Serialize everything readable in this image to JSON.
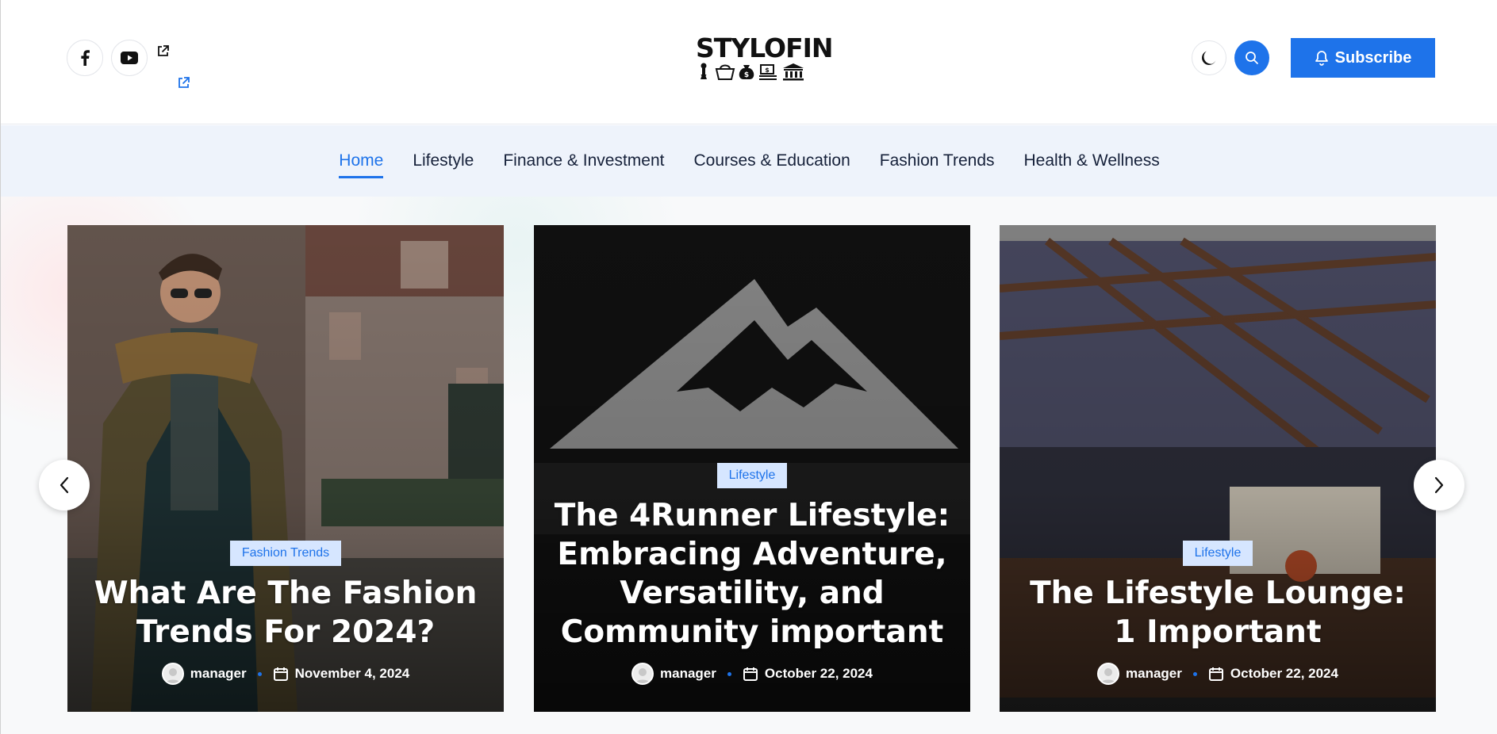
{
  "header": {
    "social": [
      {
        "icon": "facebook-icon",
        "label": "f"
      },
      {
        "icon": "youtube-icon"
      }
    ],
    "logo": {
      "text": "STYLOFIN"
    },
    "subscribe_label": "Subscribe"
  },
  "nav": {
    "items": [
      {
        "label": "Home",
        "active": true
      },
      {
        "label": "Lifestyle"
      },
      {
        "label": "Finance & Investment"
      },
      {
        "label": "Courses & Education"
      },
      {
        "label": "Fashion Trends"
      },
      {
        "label": "Health & Wellness"
      }
    ]
  },
  "slider": {
    "cards": [
      {
        "category": "Fashion Trends",
        "title": "What Are The Fashion Trends For 2024?",
        "author": "manager",
        "date": "November 4, 2024"
      },
      {
        "category": "Lifestyle",
        "title": "The 4Runner Lifestyle: Embracing Adventure, Versatility, and Community important",
        "author": "manager",
        "date": "October 22, 2024"
      },
      {
        "category": "Lifestyle",
        "title": "The Lifestyle Lounge: 1 Important",
        "author": "manager",
        "date": "October 22, 2024"
      }
    ]
  },
  "colors": {
    "accent": "#1e73ea",
    "nav_bg": "#eef3fb",
    "badge_bg": "#d6e6ff"
  }
}
